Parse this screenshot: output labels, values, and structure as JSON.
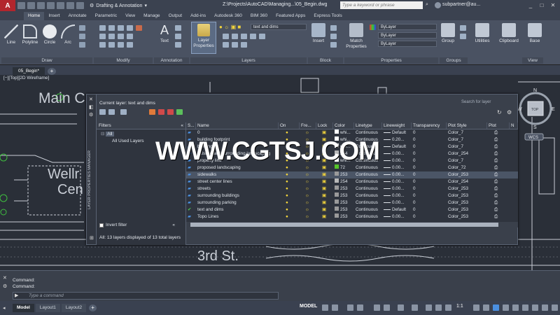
{
  "app": {
    "workspace": "Drafting & Annotation",
    "title": "Z:\\Projects\\AutoCAD\\Managing...\\05_Begin.dwg",
    "search_placeholder": "Type a keyword or phrase",
    "user": "subpartner@au..."
  },
  "ribbon": {
    "tabs": [
      "Home",
      "Insert",
      "Annotate",
      "Parametric",
      "View",
      "Manage",
      "Output",
      "Add-ins",
      "Autodesk 360",
      "BIM 360",
      "Featured Apps",
      "Express Tools"
    ],
    "active_tab": "Home",
    "tools": {
      "line": "Line",
      "polyline": "Polyline",
      "circle": "Circle",
      "arc": "Arc",
      "text": "Text",
      "layer_properties": "Layer Properties",
      "layer_combo": "text and dims",
      "insert": "Insert",
      "match_properties": "Match Properties",
      "group": "Group",
      "utilities": "Utilities",
      "clipboard": "Clipboard",
      "base": "Base",
      "bylayer1": "ByLayer",
      "bylayer2": "ByLayer",
      "bylayer3": "ByLayer"
    },
    "panels": [
      "Draw",
      "Modify",
      "Annotation",
      "Layers",
      "Block",
      "Properties",
      "Groups",
      "View"
    ]
  },
  "doc_tab": "05_Begin*",
  "viewport_label": "[−][Top][2D Wireframe]",
  "drawing_text": {
    "main": "Main C",
    "wellness": "Wellr",
    "center": "Cen",
    "street": "3rd St."
  },
  "view_cube": {
    "n": "N",
    "s": "S",
    "w": "W",
    "e": "E",
    "top": "TOP",
    "wcs": "WCS"
  },
  "layer_manager": {
    "side_title": "LAYER PROPERTIES MANAGER",
    "current_layer": "Current layer: text and dims",
    "search_placeholder": "Search for layer",
    "filters_label": "Filters",
    "tree": [
      "All",
      "All Used Layers"
    ],
    "invert_filter": "Invert filter",
    "status": "All: 13 layers displayed of 13 total layers",
    "columns": [
      "S...",
      "Name",
      "On",
      "Fre...",
      "Lock",
      "Color",
      "Linetype",
      "Lineweight",
      "Transparency",
      "Plot Style",
      "Plot",
      "N"
    ],
    "rows": [
      {
        "name": "0",
        "color": "whi...",
        "linetype": "Continuous",
        "lineweight": "Default",
        "transparency": "0",
        "plot_style": "Color_7",
        "swatch": "#ffffff"
      },
      {
        "name": "building footprint",
        "color": "whi...",
        "linetype": "Continuous",
        "lineweight": "0.20...",
        "transparency": "0",
        "plot_style": "Color_7",
        "swatch": "#ffffff"
      },
      {
        "name": "building",
        "color": "whi...",
        "linetype": "Continuous",
        "lineweight": "Default",
        "transparency": "0",
        "plot_style": "Color_7",
        "swatch": "#ffffff"
      },
      {
        "name": "existing and surrounding landscaping",
        "color": "254",
        "linetype": "Continuous",
        "lineweight": "0.00...",
        "transparency": "0",
        "plot_style": "Color_254",
        "swatch": "#b8b8b8"
      },
      {
        "name": "property line",
        "color": "whi...",
        "linetype": "Continuous",
        "lineweight": "0.00...",
        "transparency": "0",
        "plot_style": "Color_7",
        "swatch": "#ffffff"
      },
      {
        "name": "proposed landscaping",
        "color": "72",
        "linetype": "Continuous",
        "lineweight": "0.00...",
        "transparency": "0",
        "plot_style": "Color_72",
        "swatch": "#56c32a"
      },
      {
        "name": "sidewalks",
        "color": "253",
        "linetype": "Continuous",
        "lineweight": "0.00...",
        "transparency": "0",
        "plot_style": "Color_253",
        "swatch": "#9a9a9a"
      },
      {
        "name": "street center lines",
        "color": "254",
        "linetype": "Continuous",
        "lineweight": "0.00...",
        "transparency": "0",
        "plot_style": "Color_254",
        "swatch": "#b8b8b8"
      },
      {
        "name": "streets",
        "color": "253",
        "linetype": "Continuous",
        "lineweight": "0.00...",
        "transparency": "0",
        "plot_style": "Color_253",
        "swatch": "#9a9a9a"
      },
      {
        "name": "surrounding buildings",
        "color": "253",
        "linetype": "Continuous",
        "lineweight": "0.00...",
        "transparency": "0",
        "plot_style": "Color_253",
        "swatch": "#9a9a9a"
      },
      {
        "name": "surrounding parking",
        "color": "253",
        "linetype": "Continuous",
        "lineweight": "0.00...",
        "transparency": "0",
        "plot_style": "Color_253",
        "swatch": "#9a9a9a"
      },
      {
        "name": "text and dims",
        "color": "253",
        "linetype": "Continuous",
        "lineweight": "Default",
        "transparency": "0",
        "plot_style": "Color_253",
        "swatch": "#9a9a9a",
        "current": true
      },
      {
        "name": "Topo Lines",
        "color": "253",
        "linetype": "Continuous",
        "lineweight": "0.00...",
        "transparency": "0",
        "plot_style": "Color_253",
        "swatch": "#9a9a9a"
      }
    ],
    "selected_row": "sidewalks"
  },
  "watermark": "WWW.CGTSJ.COM",
  "command": {
    "line1": "Command:",
    "line2": "Command:",
    "placeholder": "Type a command"
  },
  "layout_tabs": [
    "Model",
    "Layout1",
    "Layout2"
  ],
  "status_bar": {
    "model": "MODEL",
    "scale": "1:1"
  },
  "colors": {
    "accent": "#b2262d",
    "selected_row": "#4b5566",
    "layer_blue": "#4a8fe0",
    "bulb": "#f2d43c"
  }
}
